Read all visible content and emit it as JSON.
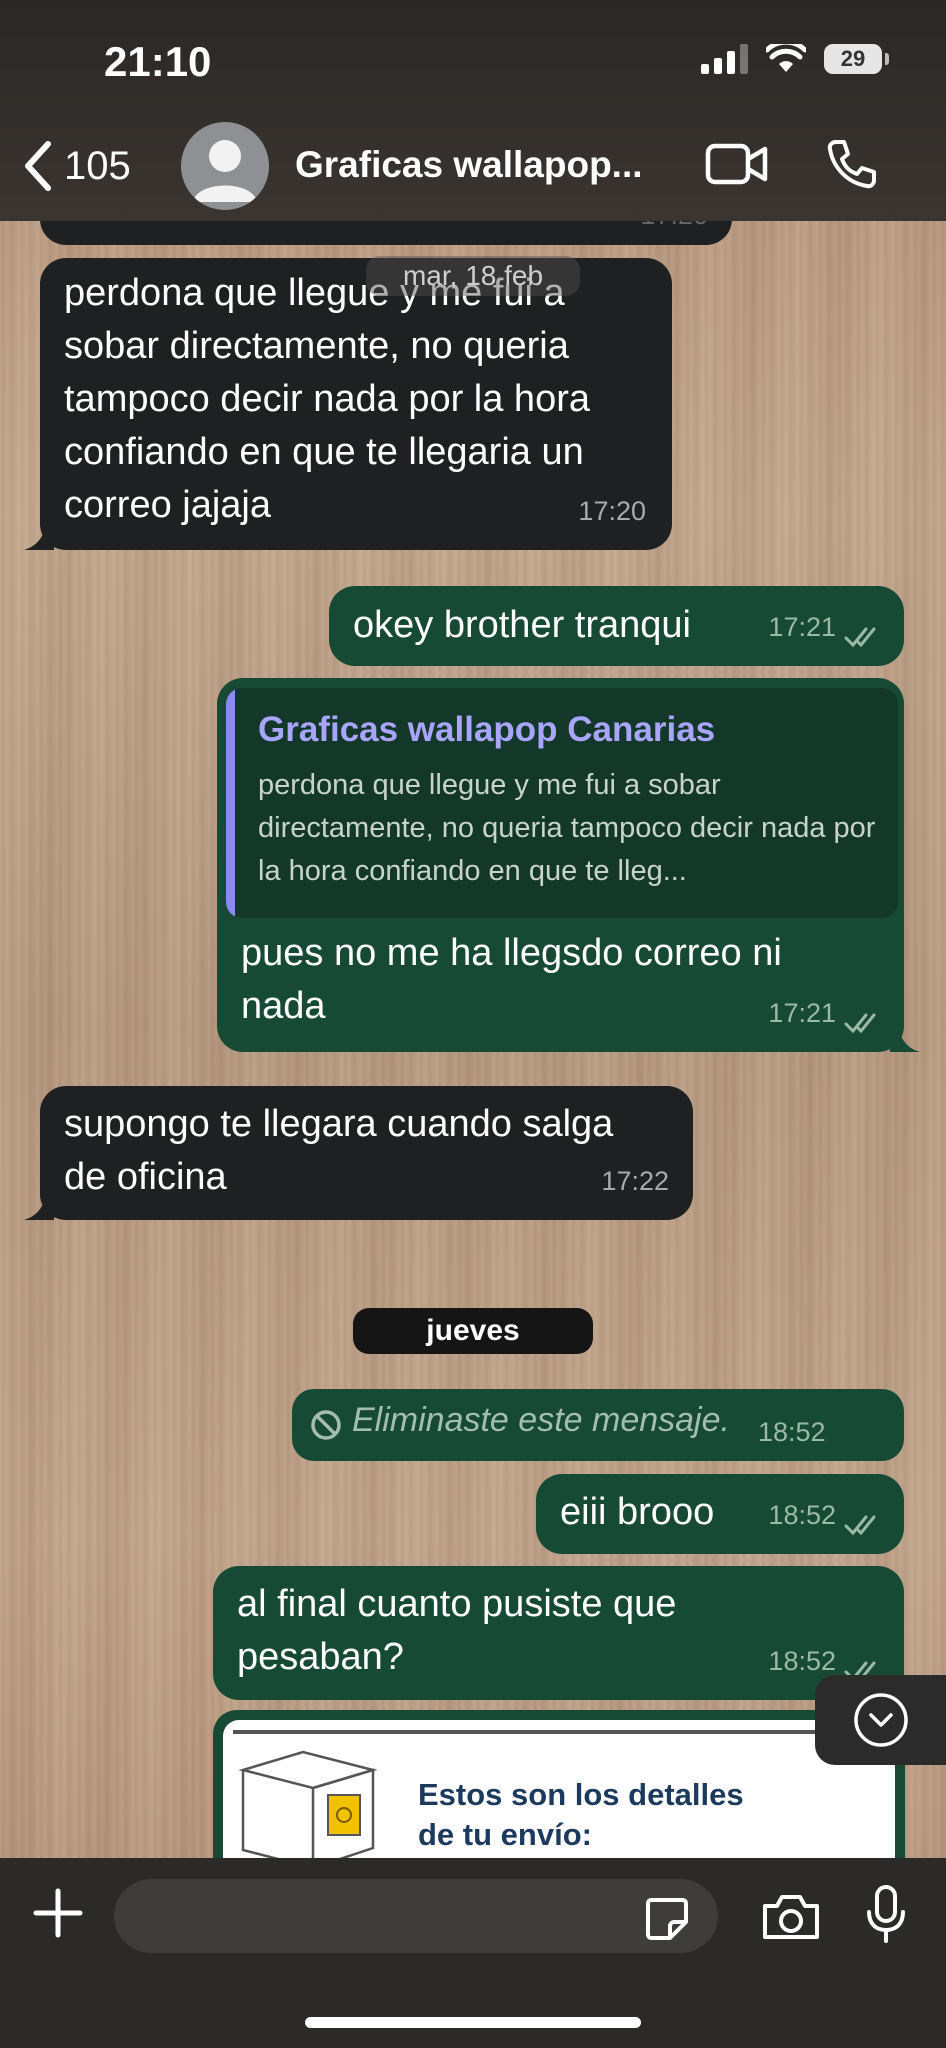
{
  "status": {
    "time": "21:10",
    "battery": "29"
  },
  "header": {
    "back_count": "105",
    "title": "Graficas wallapop..."
  },
  "colors": {
    "incoming": "#1f2021",
    "outgoing": "#174a35",
    "quote_accent": "#8b88ee"
  },
  "prev_time": "17:20",
  "date_separator": "mar, 18 feb",
  "messages": [
    {
      "dir": "in",
      "text": "perdona que llegue y me fui a sobar directamente, no  queria tampoco decir nada por la hora confiando en que te llegaria un correo jajaja",
      "time": "17:20"
    },
    {
      "dir": "out",
      "text": "okey brother tranqui",
      "time": "17:21",
      "status": "read"
    },
    {
      "dir": "out",
      "quote_author": "Graficas wallapop Canarias",
      "quote_text": "perdona que llegue y me fui a sobar directamente, no  queria tampoco decir nada por la hora confiando en que te lleg...",
      "text": "pues no me ha llegsdo correo ni nada",
      "time": "17:21",
      "status": "read"
    },
    {
      "dir": "in",
      "text": "supongo te llegara cuando salga de oficina",
      "time": "17:22"
    },
    {
      "dir": "out",
      "deleted": true,
      "text": "Eliminaste este mensaje.",
      "time": "18:52"
    },
    {
      "dir": "out",
      "text": "eiii brooo",
      "time": "18:52",
      "status": "read"
    },
    {
      "dir": "out",
      "text": "al final cuanto pusiste que pesaban?",
      "time": "18:52",
      "status": "read"
    },
    {
      "dir": "out",
      "image_caption": "Estos son los detalles de tu envío:"
    }
  ],
  "day_separator": "jueves",
  "input": {
    "placeholder": ""
  },
  "icons": [
    "chevron-left-icon",
    "avatar-icon",
    "video-call-icon",
    "phone-icon",
    "ban-icon",
    "double-check-icon",
    "scroll-down-icon",
    "plus-icon",
    "sticker-icon",
    "camera-icon",
    "mic-icon"
  ]
}
